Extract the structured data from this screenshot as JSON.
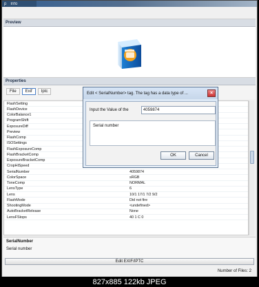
{
  "window": {
    "menu": [
      "p",
      "Info"
    ],
    "menu_icon": "window-menu-icon"
  },
  "preview": {
    "title": "Preview",
    "image": "software-box-preview-image"
  },
  "properties": {
    "title": "Properties",
    "tabs": [
      "File",
      "Exif",
      "Iptc"
    ],
    "active_tab": "Exif",
    "tool_icon": "properties-tool-icon",
    "rows": [
      [
        "FlashSetting",
        ""
      ],
      [
        "FlashDevice",
        ""
      ],
      [
        "ColorBalance1",
        ""
      ],
      [
        "ProgramShift",
        ""
      ],
      [
        "ExposureDiff",
        ""
      ],
      [
        "Preview",
        ""
      ],
      [
        "FlashComp",
        ""
      ],
      [
        "ISOSettings",
        ""
      ],
      [
        "FlashExposureComp",
        ""
      ],
      [
        "FlashBracketComp",
        ""
      ],
      [
        "ExposureBracketComp",
        ""
      ],
      [
        "CropHiSpeed",
        "0 3904 2616 3904 2616 0 0"
      ],
      [
        "SerialNumber",
        "4059874"
      ],
      [
        "ColorSpace",
        "sRGB"
      ],
      [
        "ToneComp",
        "NORMAL"
      ],
      [
        "LensType",
        "6"
      ],
      [
        "Lens",
        "10/1 17/1 7/2 9/2"
      ],
      [
        "FlashMode",
        "Did not fire"
      ],
      [
        "ShootingMode",
        "<undefined>"
      ],
      [
        "AutoBracketRelease",
        "None"
      ],
      [
        "LensFStops",
        "40  1  C  0"
      ]
    ]
  },
  "description": {
    "title": "SerialNumber",
    "body": "Serial number"
  },
  "action": {
    "label": "Edit EXIF/IPTC"
  },
  "status": {
    "files_label": "Number of Files: 2"
  },
  "dialog": {
    "title": "Edit < SerialNumber> tag. The tag has a data type of ...",
    "input_label": "Input the Value of the",
    "input_value": "4059874",
    "description": "Serial number",
    "ok": "OK",
    "cancel": "Cancel",
    "close_icon": "close-icon"
  },
  "watermark": {
    "text": "827x885 122kb JPEG"
  }
}
